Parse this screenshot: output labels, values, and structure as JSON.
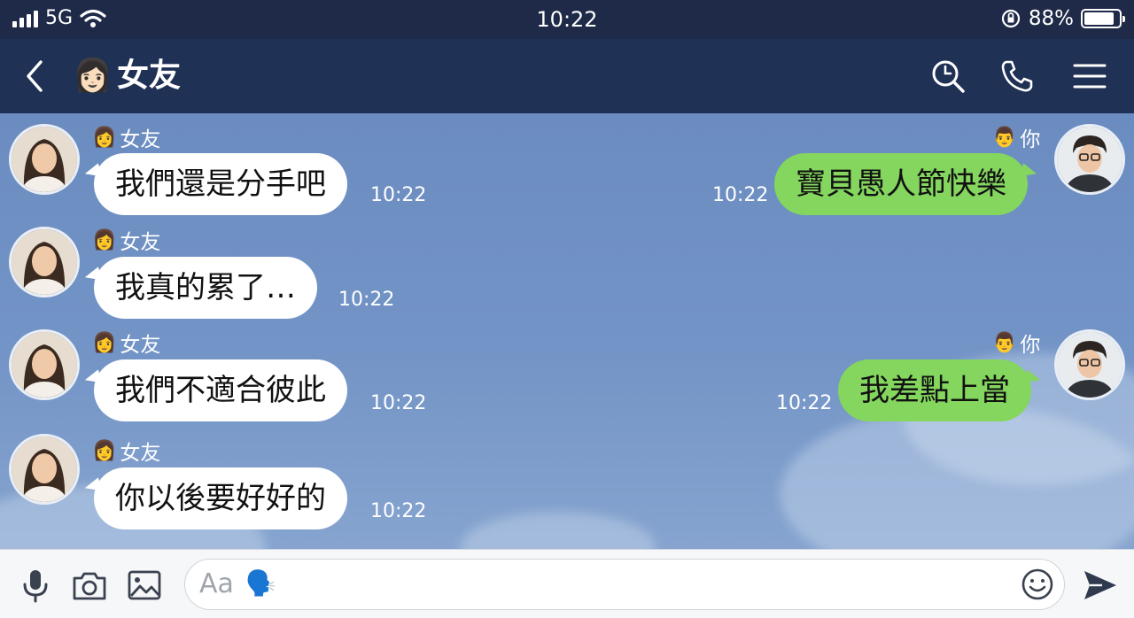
{
  "status_bar": {
    "network": "5G",
    "time": "10:22",
    "battery": "88%",
    "battery_level": 0.88
  },
  "header": {
    "emoji": "👩🏻",
    "title": "女友"
  },
  "contact": {
    "emoji": "👩",
    "name": "女友"
  },
  "me": {
    "emoji": "👨",
    "name": "你"
  },
  "messages": [
    {
      "side": "left",
      "text": "我們還是分手吧",
      "time": "10:22"
    },
    {
      "side": "right",
      "text": "寶貝愚人節快樂",
      "time": "10:22"
    },
    {
      "side": "left",
      "text": "我真的累了…",
      "time": "10:22"
    },
    {
      "side": "left",
      "text": "我們不適合彼此",
      "time": "10:22"
    },
    {
      "side": "right",
      "text": "我差點上當",
      "time": "10:22"
    },
    {
      "side": "left",
      "text": "你以後要好好的",
      "time": "10:22"
    }
  ],
  "input": {
    "placeholder": "Aa",
    "voice_emoji": "🗣️"
  },
  "colors": {
    "header": "#203156",
    "status_bar": "#1e2a48",
    "my_bubble": "#84d65e",
    "their_bubble": "#ffffff",
    "chat_bg": "#6f8fc0"
  },
  "icons": [
    "back-icon",
    "search-icon",
    "phone-icon",
    "menu-icon",
    "microphone-icon",
    "camera-icon",
    "image-icon",
    "emoji-icon",
    "send-icon"
  ]
}
